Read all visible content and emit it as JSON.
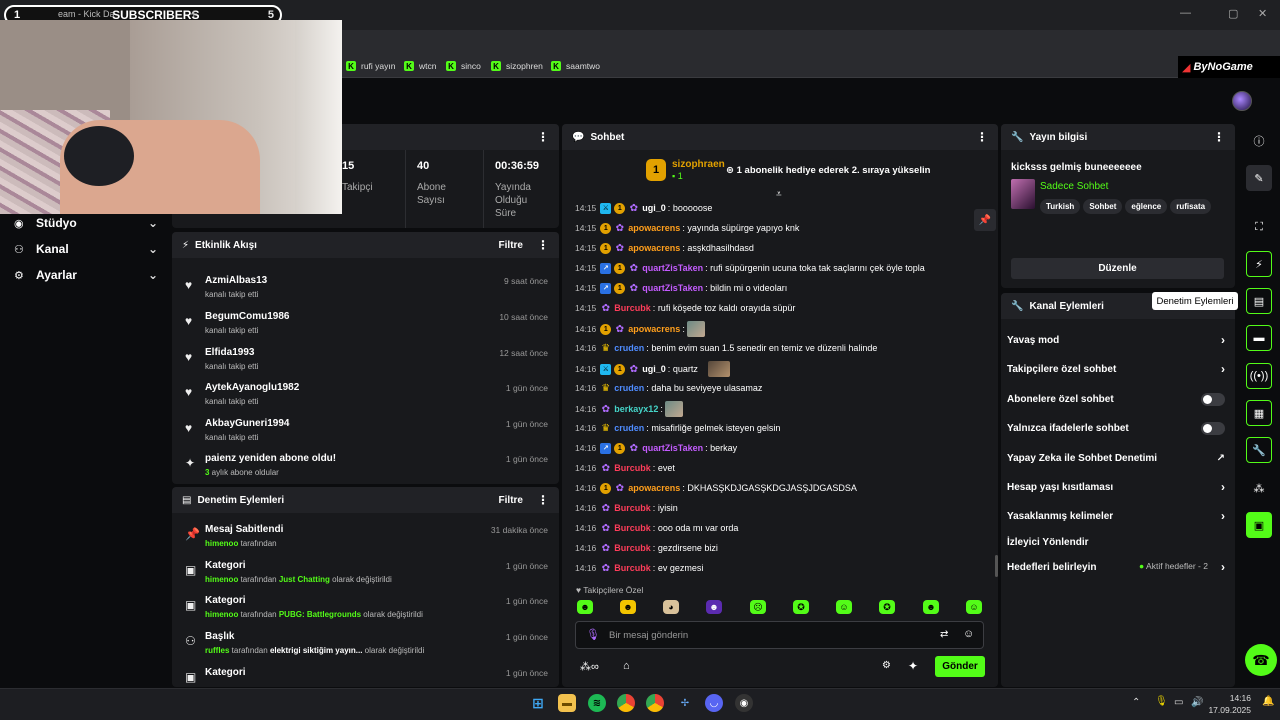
{
  "browser": {
    "tab_number": "1",
    "tab_title": "eam - Kick Da",
    "subscribers_label": "SUBSCRIBERS",
    "subscribers_count": "5",
    "new_tab": "+",
    "bookmarks": [
      "rufi yayın",
      "wtcn",
      "sinco",
      "sizophren",
      "saamtwo"
    ],
    "logo_text": "ByNoGame"
  },
  "nav": {
    "items": [
      {
        "label": "Stüdyo",
        "icon": "studio-icon"
      },
      {
        "label": "Kanal",
        "icon": "channel-icon"
      },
      {
        "label": "Ayarlar",
        "icon": "gear-icon"
      }
    ]
  },
  "stats": {
    "followers_value": "15",
    "followers_label": "Takipçi",
    "subs_value": "40",
    "subs_label_1": "Abone",
    "subs_label_2": "Sayısı",
    "uptime_value": "00:36:59",
    "uptime_label_1": "Yayında",
    "uptime_label_2": "Olduğu",
    "uptime_label_3": "Süre"
  },
  "activity": {
    "title": "Etkinlik Akışı",
    "filter": "Filtre",
    "rows": [
      {
        "name": "AzmiAlbas13",
        "sub": "kanalı takip etti",
        "time": "9 saat önce"
      },
      {
        "name": "BegumComu1986",
        "sub": "kanalı takip etti",
        "time": "10 saat önce"
      },
      {
        "name": "Elfida1993",
        "sub": "kanalı takip etti",
        "time": "12 saat önce"
      },
      {
        "name": "AytekAyanoglu1982",
        "sub": "kanalı takip etti",
        "time": "1 gün önce"
      },
      {
        "name": "AkbayGuneri1994",
        "sub": "kanalı takip etti",
        "time": "1 gün önce"
      },
      {
        "name": "paienz yeniden abone oldu!",
        "sub_highlight": "3",
        "sub": " aylık abone oldular",
        "time": "1 gün önce"
      }
    ]
  },
  "modactions": {
    "title": "Denetim Eylemleri",
    "filter": "Filtre",
    "rows": [
      {
        "name": "Mesaj Sabitlendi",
        "user": "himenoo",
        "by": " tarafından",
        "target": "",
        "suffix": "",
        "time": "31 dakika önce"
      },
      {
        "name": "Kategori",
        "user": "himenoo",
        "by": " tarafından ",
        "target": "Just Chatting",
        "suffix": " olarak değiştirildi",
        "time": "1 gün önce"
      },
      {
        "name": "Kategori",
        "user": "himenoo",
        "by": " tarafından ",
        "target": "PUBG: Battlegrounds",
        "suffix": " olarak değiştirildi",
        "time": "1 gün önce"
      },
      {
        "name": "Başlık",
        "user": "ruffles",
        "by": " tarafından ",
        "target": "elektrigi siktiğim yayın...",
        "suffix": " olarak değiştirildi",
        "time": "1 gün önce"
      },
      {
        "name": "Kategori",
        "user": "",
        "by": "",
        "target": "",
        "suffix": "",
        "time": "1 gün önce"
      }
    ]
  },
  "chat": {
    "title": "Sohbet",
    "pinned_user": "sizophraen",
    "pinned_count": "1",
    "pinned_text": "1 abonelik hediye ederek 2. sıraya yükselin",
    "messages": [
      {
        "t": "14:15",
        "user": "ugi_0",
        "color": "#ffffff",
        "text": "booooose"
      },
      {
        "t": "14:15",
        "user": "apowacrens",
        "color": "#ff9f1c",
        "text": "yayında süpürge yapıyo knk"
      },
      {
        "t": "14:15",
        "user": "apowacrens",
        "color": "#ff9f1c",
        "text": "asşkdhasilhdasd"
      },
      {
        "t": "14:15",
        "user": "quartZisTaken",
        "color": "#c45cff",
        "text": "rufi süpürgenin ucuna toka tak saçlarını çek öyle topla"
      },
      {
        "t": "14:15",
        "user": "quartZisTaken",
        "color": "#c45cff",
        "text": "bildin mi o videoları"
      },
      {
        "t": "14:15",
        "user": "Burcubk",
        "color": "#ff3d5a",
        "text": "rufi köşede toz kaldı orayıda süpür"
      },
      {
        "t": "14:16",
        "user": "apowacrens",
        "color": "#ff9f1c",
        "text": ""
      },
      {
        "t": "14:16",
        "user": "cruden",
        "color": "#4f8cff",
        "text": "benim evim suan 1.5 senedir en temiz ve düzenli halinde"
      },
      {
        "t": "14:16",
        "user": "ugi_0",
        "color": "#ffffff",
        "text": "quartz"
      },
      {
        "t": "14:16",
        "user": "cruden",
        "color": "#4f8cff",
        "text": "daha bu seviyeye ulasamaz"
      },
      {
        "t": "14:16",
        "user": "berkayx12",
        "color": "#45d4c8",
        "text": ""
      },
      {
        "t": "14:16",
        "user": "cruden",
        "color": "#4f8cff",
        "text": "misafirliğe gelmek isteyen gelsin"
      },
      {
        "t": "14:16",
        "user": "quartZisTaken",
        "color": "#c45cff",
        "text": "berkay"
      },
      {
        "t": "14:16",
        "user": "Burcubk",
        "color": "#ff3d5a",
        "text": "evet"
      },
      {
        "t": "14:16",
        "user": "apowacrens",
        "color": "#ff9f1c",
        "text": "DKHASŞKDJGASŞKDGJASŞJDGASDSA"
      },
      {
        "t": "14:16",
        "user": "Burcubk",
        "color": "#ff3d5a",
        "text": "iyisin"
      },
      {
        "t": "14:16",
        "user": "Burcubk",
        "color": "#ff3d5a",
        "text": "ooo oda mı var orda"
      },
      {
        "t": "14:16",
        "user": "Burcubk",
        "color": "#ff3d5a",
        "text": "gezdirsene bizi"
      },
      {
        "t": "14:16",
        "user": "Burcubk",
        "color": "#ff3d5a",
        "text": "ev gezmesi"
      }
    ],
    "followers_only": "Takipçilere Özel",
    "input_placeholder": "Bir mesaj gönderin",
    "send": "Gönder"
  },
  "streaminfo": {
    "title": "Yayın bilgisi",
    "stream_title": "kicksss gelmiş buneeeeeee",
    "category": "Sadece Sohbet",
    "tags": [
      "Turkish",
      "Sohbet",
      "eğlence",
      "rufisata"
    ],
    "edit": "Düzenle"
  },
  "channelactions": {
    "title": "Kanal Eylemleri",
    "items": [
      {
        "label": "Yavaş mod",
        "kind": "chevron"
      },
      {
        "label": "Takipçilere özel sohbet",
        "kind": "chevron"
      },
      {
        "label": "Abonelere özel sohbet",
        "kind": "toggle"
      },
      {
        "label": "Yalnızca ifadelerle sohbet",
        "kind": "toggle"
      },
      {
        "label": "Yapay Zeka ile Sohbet Denetimi",
        "kind": "external"
      },
      {
        "label": "Hesap yaşı kısıtlaması",
        "kind": "chevron"
      },
      {
        "label": "Yasaklanmış kelimeler",
        "kind": "chevron"
      },
      {
        "label": "İzleyici Yönlendir",
        "kind": "none"
      },
      {
        "label": "Hedefleri belirleyin",
        "kind": "chevron"
      }
    ],
    "goals_status": "Aktif hedefler - 2"
  },
  "tooltip": "Denetim Eylemleri",
  "taskbar": {
    "time": "14:16",
    "date": "17.09.2025"
  }
}
